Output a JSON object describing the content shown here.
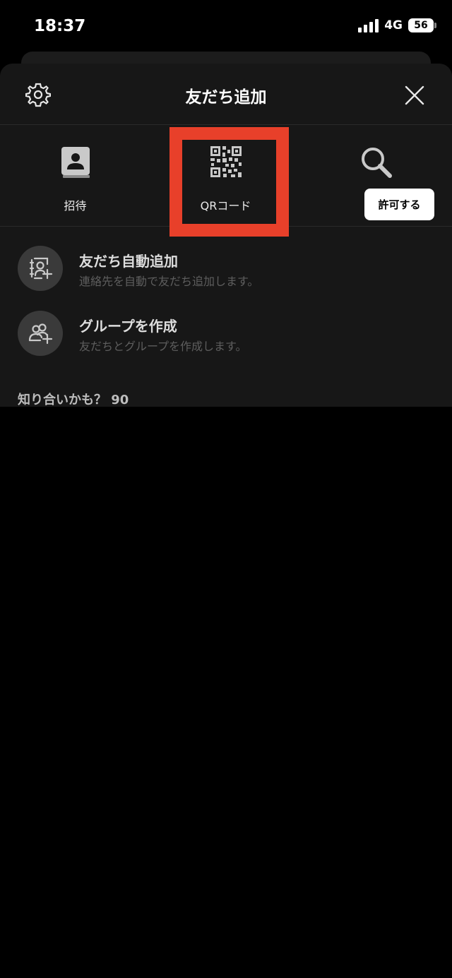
{
  "status_bar": {
    "time": "18:37",
    "network": "4G",
    "battery": "56"
  },
  "header": {
    "title": "友だち追加",
    "settings_icon": "gear-icon",
    "close_icon": "close-icon"
  },
  "actions": [
    {
      "label": "招待",
      "icon": "contact-book-icon"
    },
    {
      "label": "QRコード",
      "icon": "qr-code-icon"
    },
    {
      "label": "検索",
      "icon": "search-icon"
    }
  ],
  "rows": [
    {
      "title": "友だち自動追加",
      "subtitle": "連絡先を自動で友だち追加します。",
      "icon": "contact-add-icon",
      "button": "許可する"
    },
    {
      "title": "グループを作成",
      "subtitle": "友だちとグループを作成します。",
      "icon": "group-add-icon"
    }
  ],
  "suggestions": {
    "title": "知り合いかも？ 90"
  },
  "colors": {
    "highlight": "#e8402a",
    "sheet": "#171717"
  }
}
